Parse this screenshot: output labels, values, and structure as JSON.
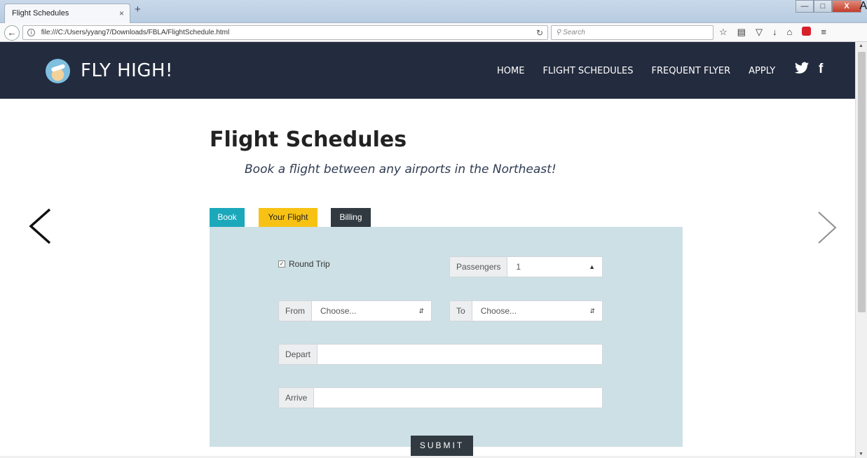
{
  "browser": {
    "tab_title": "Flight Schedules",
    "tab_close": "×",
    "new_tab": "+",
    "url": "file:///C:/Users/yyang7/Downloads/FBLA/FlightSchedule.html",
    "search_placeholder": "Search",
    "stray_glyph": "A",
    "window_buttons": [
      "—",
      "□",
      "X"
    ]
  },
  "site": {
    "brand": "FLY HIGH!",
    "nav": [
      "HOME",
      "FLIGHT SCHEDULES",
      "FREQUENT FLYER",
      "APPLY"
    ],
    "social_icons": [
      "twitter-icon",
      "facebook-icon"
    ],
    "colors": {
      "header": "#232b3e",
      "book_tab": "#1ba8bb",
      "your_flight_tab": "#f7c214",
      "billing_tab": "#303a40",
      "panel": "#cde0e6"
    }
  },
  "page": {
    "title": "Flight Schedules",
    "subtitle": "Book a flight between any airports in the Northeast!"
  },
  "tabs": [
    "Book",
    "Your Flight",
    "Billing"
  ],
  "form": {
    "round_trip_label": "Round Trip",
    "round_trip_checked": true,
    "passengers_label": "Passengers",
    "passengers_value": "1",
    "from_label": "From",
    "from_value": "Choose...",
    "to_label": "To",
    "to_value": "Choose...",
    "depart_label": "Depart",
    "depart_value": "",
    "arrive_label": "Arrive",
    "arrive_value": "",
    "submit_label": "SUBMIT"
  }
}
